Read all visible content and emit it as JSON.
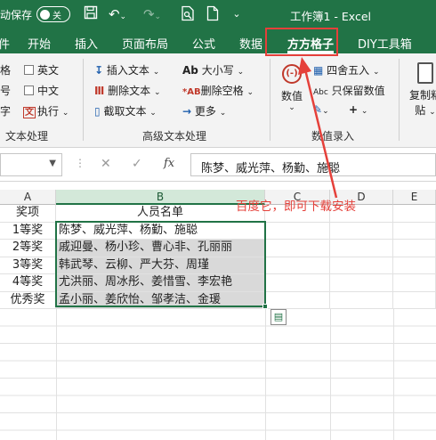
{
  "titlebar": {
    "autosave_label": "自动保存",
    "autosave_state": "关",
    "doc_title": "工作簿1 - Excel",
    "icons": [
      "save-icon",
      "undo-icon",
      "redo-icon",
      "print-preview-icon",
      "new-file-icon",
      "customize-qat-icon"
    ],
    "bg_color": "#217346"
  },
  "tabs": {
    "items": [
      "件",
      "开始",
      "插入",
      "页面布局",
      "公式",
      "数据",
      "方方格子",
      "DIY工具箱"
    ],
    "active": "方方格子"
  },
  "ribbon": {
    "text_group": {
      "items_left": [
        "空格",
        "符号",
        "文字"
      ],
      "english": "英文",
      "chinese": "中文",
      "execute": "执行",
      "label": "文本处理"
    },
    "advanced_group": {
      "insert_text": "插入文本",
      "delete_text": "删除文本",
      "extract_text": "截取文本",
      "case": "大小写",
      "delete_spaces": "删除空格",
      "more": "更多",
      "label": "高级文本处理"
    },
    "number_group": {
      "numeric": "数值",
      "round": "四舍五入",
      "keep_value": "只保留数值",
      "label": "数值录入"
    },
    "paste_group": {
      "line1": "复制粘",
      "line2": "贴"
    }
  },
  "formula_bar": {
    "cancel": "✕",
    "enter": "✓",
    "fx": "fx",
    "content": "陈梦、威光萍、杨勤、施聪"
  },
  "grid": {
    "columns": [
      "A",
      "B",
      "C",
      "D",
      "E"
    ],
    "header_row": [
      "奖项",
      "人员名单"
    ],
    "rows": [
      [
        "1等奖",
        "陈梦、威光萍、杨勤、施聪"
      ],
      [
        "2等奖",
        "戚迎曼、杨小珍、曹心非、孔丽丽"
      ],
      [
        "3等奖",
        "韩武琴、云柳、严大芬、周瑾"
      ],
      [
        "4等奖",
        "尤洪丽、周冰彤、姜惜雪、李宏艳"
      ],
      [
        "优秀奖",
        "孟小丽、姜欣怡、邹孝洁、金瑗"
      ]
    ]
  },
  "annotation": {
    "text": "百度它，即可下载安装",
    "color": "#e5403a"
  }
}
